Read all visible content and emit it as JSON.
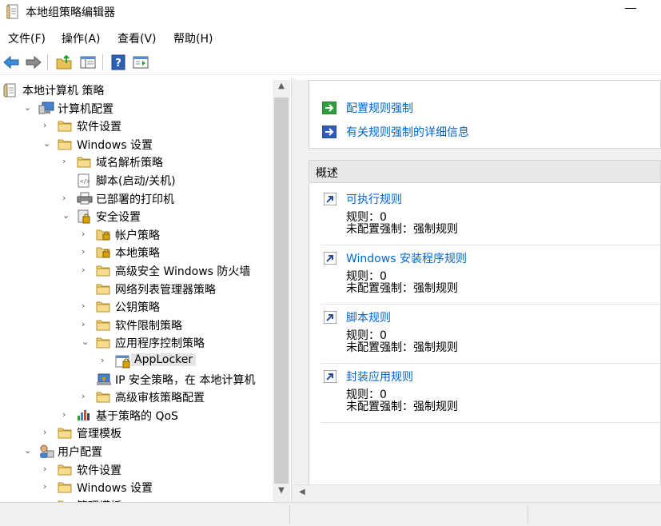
{
  "window": {
    "title": "本地组策略编辑器"
  },
  "menu": [
    "文件(F)",
    "操作(A)",
    "查看(V)",
    "帮助(H)"
  ],
  "toolbar": {
    "buttons": [
      "back-arrow-icon",
      "forward-arrow-icon",
      "up-folder-icon",
      "show-hide-tree-icon",
      "help-icon",
      "properties-icon"
    ]
  },
  "tree": [
    {
      "label": "本地计算机 策略",
      "icon": "policy-doc-icon",
      "depth": 0,
      "chevron": ""
    },
    {
      "label": "计算机配置",
      "icon": "computer-icon",
      "depth": 1,
      "chevron": "expanded"
    },
    {
      "label": "软件设置",
      "icon": "folder-icon",
      "depth": 2,
      "chevron": "collapsed"
    },
    {
      "label": "Windows 设置",
      "icon": "folder-icon",
      "depth": 2,
      "chevron": "expanded"
    },
    {
      "label": "域名解析策略",
      "icon": "folder-icon",
      "depth": 3,
      "chevron": "collapsed"
    },
    {
      "label": "脚本(启动/关机)",
      "icon": "script-icon",
      "depth": 3,
      "chevron": ""
    },
    {
      "label": "已部署的打印机",
      "icon": "printer-icon",
      "depth": 3,
      "chevron": "collapsed"
    },
    {
      "label": "安全设置",
      "icon": "security-icon",
      "depth": 3,
      "chevron": "expanded"
    },
    {
      "label": "帐户策略",
      "icon": "folder-lock-icon",
      "depth": 4,
      "chevron": "collapsed"
    },
    {
      "label": "本地策略",
      "icon": "folder-lock-icon",
      "depth": 4,
      "chevron": "collapsed"
    },
    {
      "label": "高级安全 Windows 防火墙",
      "icon": "folder-icon",
      "depth": 4,
      "chevron": "collapsed"
    },
    {
      "label": "网络列表管理器策略",
      "icon": "folder-icon",
      "depth": 4,
      "chevron": ""
    },
    {
      "label": "公钥策略",
      "icon": "folder-icon",
      "depth": 4,
      "chevron": "collapsed"
    },
    {
      "label": "软件限制策略",
      "icon": "folder-icon",
      "depth": 4,
      "chevron": "collapsed"
    },
    {
      "label": "应用程序控制策略",
      "icon": "folder-icon",
      "depth": 4,
      "chevron": "expanded"
    },
    {
      "label": "AppLocker",
      "icon": "applocker-icon",
      "depth": 5,
      "chevron": "collapsed",
      "selected": true
    },
    {
      "label": "IP 安全策略，在 本地计算机",
      "icon": "ipsec-icon",
      "depth": 4,
      "chevron": ""
    },
    {
      "label": "高级审核策略配置",
      "icon": "folder-icon",
      "depth": 4,
      "chevron": "collapsed"
    },
    {
      "label": "基于策略的 QoS",
      "icon": "chart-icon",
      "depth": 3,
      "chevron": "collapsed"
    },
    {
      "label": "管理模板",
      "icon": "folder-icon",
      "depth": 2,
      "chevron": "collapsed"
    },
    {
      "label": "用户配置",
      "icon": "user-icon",
      "depth": 1,
      "chevron": "expanded"
    },
    {
      "label": "软件设置",
      "icon": "folder-icon",
      "depth": 2,
      "chevron": "collapsed"
    },
    {
      "label": "Windows 设置",
      "icon": "folder-icon",
      "depth": 2,
      "chevron": "collapsed"
    },
    {
      "label": "管理模板",
      "icon": "folder-icon",
      "depth": 2,
      "chevron": "collapsed"
    }
  ],
  "actions": [
    {
      "label": "配置规则强制",
      "icon": "green-arrow-icon"
    },
    {
      "label": "有关规则强制的详细信息",
      "icon": "blue-arrow-icon"
    }
  ],
  "overview": {
    "header": "概述",
    "rules": [
      {
        "name": "可执行规则",
        "line1": "规则：0",
        "line2": "未配置强制：强制规则"
      },
      {
        "name": "Windows 安装程序规则",
        "line1": "规则：0",
        "line2": "未配置强制：强制规则"
      },
      {
        "name": "脚本规则",
        "line1": "规则：0",
        "line2": "未配置强制：强制规则"
      },
      {
        "name": "封装应用规则",
        "line1": "规则：0",
        "line2": "未配置强制：强制规则"
      }
    ]
  },
  "colors": {
    "link": "#0066cc",
    "folder": "#e8c15a",
    "selection": "#e5e5e5"
  }
}
